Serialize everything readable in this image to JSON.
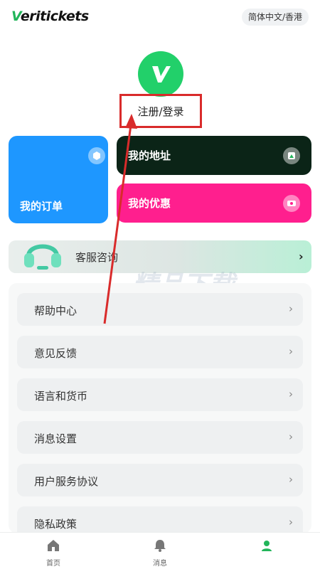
{
  "header": {
    "logo_v": "V",
    "logo_rest": "eritickets",
    "language_button": "简体中文/香港"
  },
  "profile": {
    "login_label": "注册/登录"
  },
  "cards": {
    "orders": "我的订单",
    "address": "我的地址",
    "coupon": "我的优惠"
  },
  "support": {
    "label": "客服咨询",
    "chevron": "›"
  },
  "menu": {
    "items": [
      {
        "label": "帮助中心"
      },
      {
        "label": "意见反馈"
      },
      {
        "label": "语言和货币"
      },
      {
        "label": "消息设置"
      },
      {
        "label": "用户服务协议"
      },
      {
        "label": "隐私政策"
      }
    ],
    "chevron": "›"
  },
  "watermark": "精品下载",
  "bottom_nav": {
    "home": "首页",
    "messages": "消息"
  },
  "colors": {
    "brand_green": "#22d06a",
    "orders_blue": "#1e97ff",
    "address_dark": "#0b2417",
    "coupon_pink": "#ff1f8e",
    "annotation_red": "#d92b2b"
  }
}
